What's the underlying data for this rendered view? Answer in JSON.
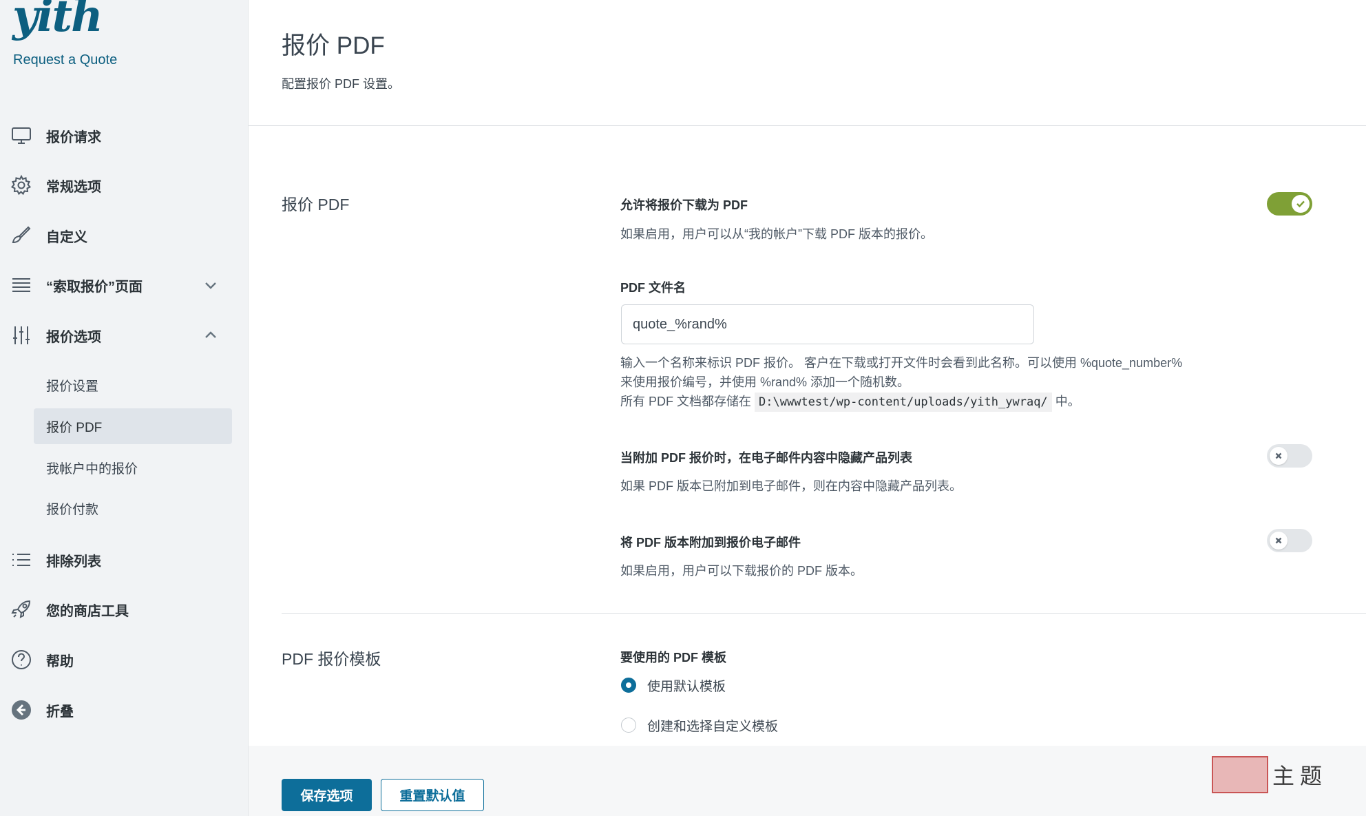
{
  "brand": {
    "logo": "yith",
    "subtitle": "Request a Quote"
  },
  "sidebar": {
    "items": [
      {
        "label": "报价请求",
        "icon": "monitor-icon"
      },
      {
        "label": "常规选项",
        "icon": "gear-icon"
      },
      {
        "label": "自定义",
        "icon": "brush-icon"
      },
      {
        "label": "“索取报价”页面",
        "icon": "layers-icon",
        "chevron": "down"
      },
      {
        "label": "报价选项",
        "icon": "sliders-icon",
        "chevron": "up"
      },
      {
        "label": "排除列表",
        "icon": "list-icon"
      },
      {
        "label": "您的商店工具",
        "icon": "rocket-icon"
      },
      {
        "label": "帮助",
        "icon": "help-icon"
      },
      {
        "label": "折叠",
        "icon": "arrow-left-circle-icon"
      }
    ],
    "subitems": [
      {
        "label": "报价设置"
      },
      {
        "label": "报价 PDF",
        "active": true
      },
      {
        "label": "我帐户中的报价"
      },
      {
        "label": "报价付款"
      }
    ]
  },
  "header": {
    "title": "报价 PDF",
    "subtitle": "配置报价 PDF 设置。"
  },
  "sections": {
    "pdf": {
      "title": "报价 PDF",
      "allow_download": {
        "label": "允许将报价下载为 PDF",
        "desc": "如果启用，用户可以从“我的帐户”下载 PDF 版本的报价。",
        "enabled": true
      },
      "filename": {
        "label": "PDF 文件名",
        "value": "quote_%rand%",
        "desc1": "输入一个名称来标识 PDF 报价。 客户在下载或打开文件时会看到此名称。可以使用 %quote_number%",
        "desc2": "来使用报价编号，并使用 %rand% 添加一个随机数。",
        "desc3_pre": "所有 PDF 文档都存储在",
        "desc3_path": "D:\\wwwtest/wp-content/uploads/yith_ywraq/",
        "desc3_post": "中。"
      },
      "hide_products": {
        "label": "当附加 PDF 报价时，在电子邮件内容中隐藏产品列表",
        "desc": "如果 PDF 版本已附加到电子邮件，则在内容中隐藏产品列表。",
        "enabled": false
      },
      "attach_pdf": {
        "label": "将 PDF 版本附加到报价电子邮件",
        "desc": "如果启用，用户可以下载报价的 PDF 版本。",
        "enabled": false
      }
    },
    "template": {
      "title": "PDF 报价模板",
      "label": "要使用的 PDF 模板",
      "options": [
        {
          "label": "使用默认模板",
          "checked": true
        },
        {
          "label": "创建和选择自定义模板",
          "checked": false
        }
      ]
    }
  },
  "footer": {
    "save_label": "保存选项",
    "reset_label": "重置默认值"
  },
  "watermark": {
    "text": "主题"
  },
  "colors": {
    "accent": "#0d6e9a",
    "toggle_on": "#7fa036",
    "brand": "#0d5f80"
  }
}
